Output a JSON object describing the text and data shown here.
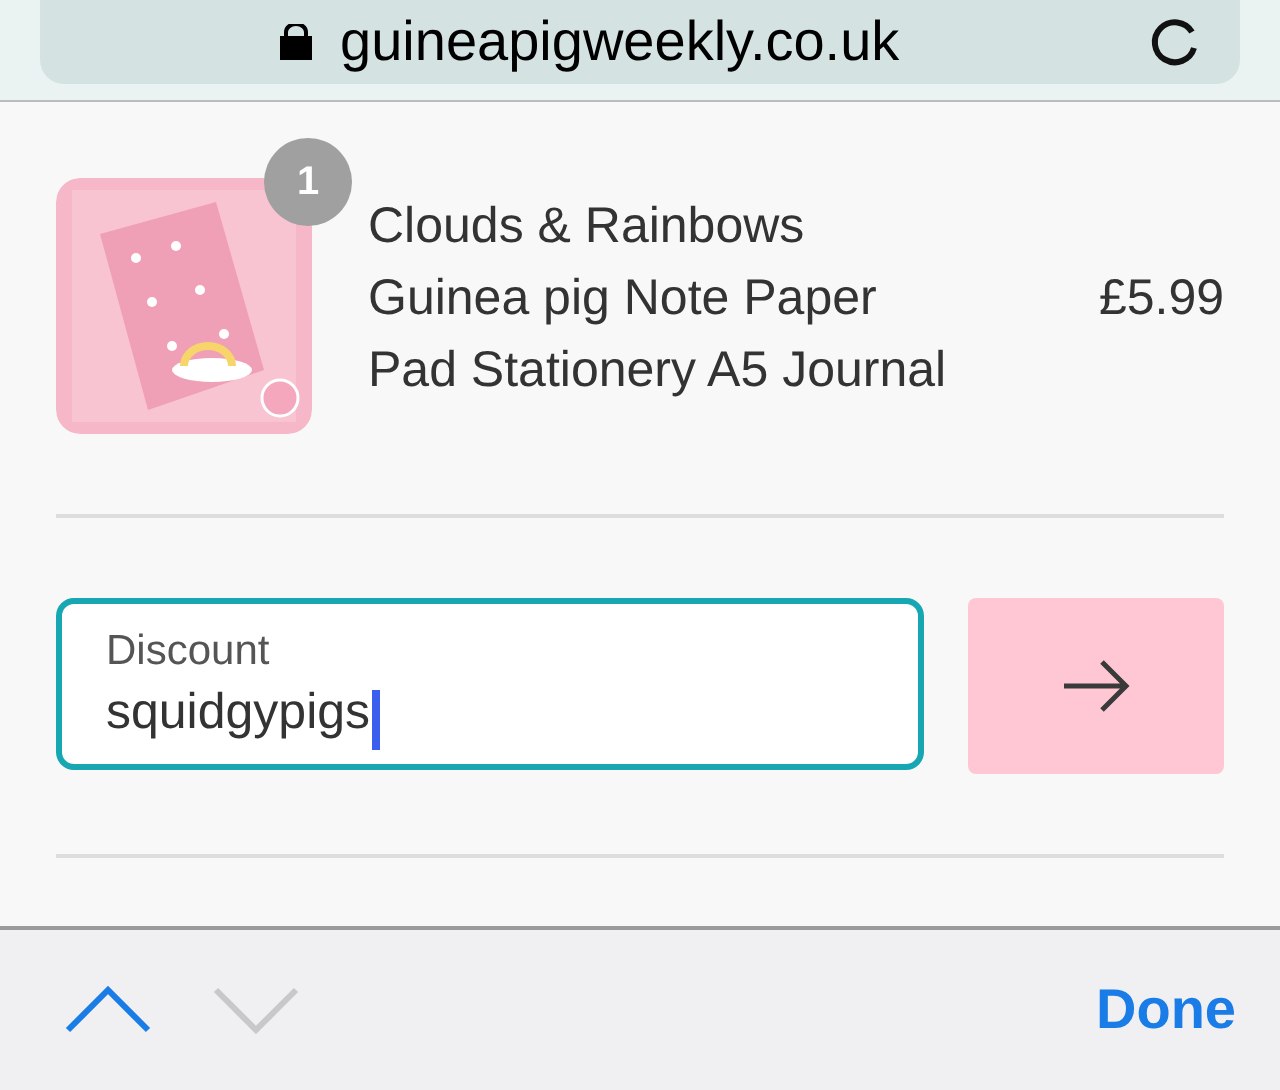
{
  "address_bar": {
    "url": "guineapigweekly.co.uk"
  },
  "cart_item": {
    "quantity": "1",
    "title": "Clouds & Rainbows Guinea pig Note Paper Pad Stationery A5 Journal",
    "price": "£5.99"
  },
  "discount": {
    "label": "Discount",
    "value": "squidgypigs",
    "focused": true
  },
  "keyboard_toolbar": {
    "previous_enabled": true,
    "next_enabled": false,
    "done": "Done"
  }
}
